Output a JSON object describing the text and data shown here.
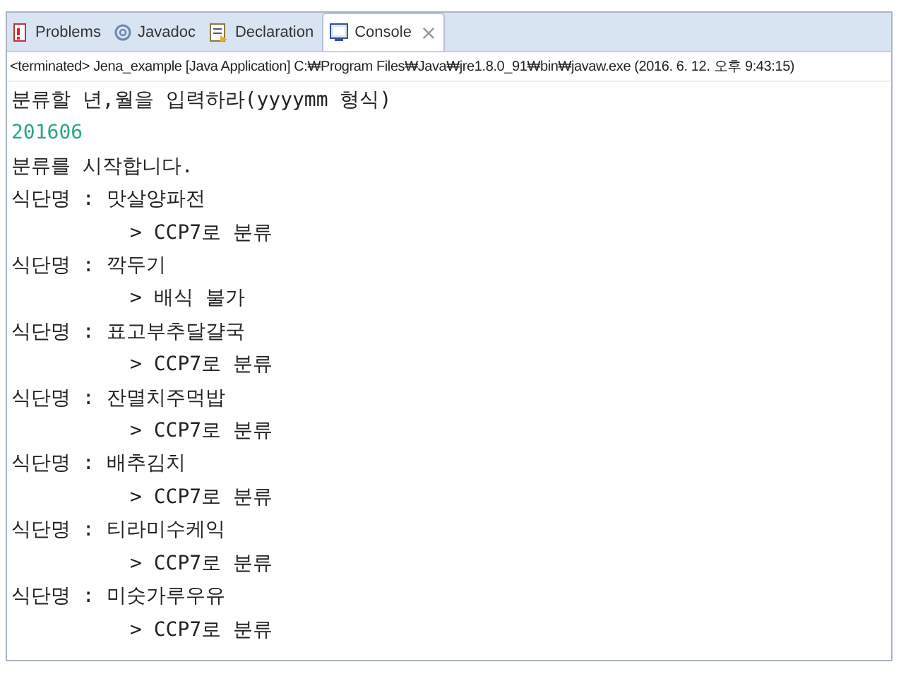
{
  "tabs": [
    {
      "label": "Problems",
      "selected": false
    },
    {
      "label": "Javadoc",
      "selected": false
    },
    {
      "label": "Declaration",
      "selected": false
    },
    {
      "label": "Console",
      "selected": true
    }
  ],
  "console_header": "<terminated> Jena_example [Java Application] C:₩Program Files₩Java₩jre1.8.0_91₩bin₩javaw.exe (2016. 6. 12. 오후 9:43:15)",
  "output_lines": [
    {
      "kind": "output",
      "text": "분류할 년,월을 입력하라(yyyymm 형식)"
    },
    {
      "kind": "input",
      "text": "201606"
    },
    {
      "kind": "output",
      "text": "분류를 시작합니다."
    },
    {
      "kind": "output",
      "text": "식단명 : 맛살양파전"
    },
    {
      "kind": "indented",
      "text": "> CCP7로 분류"
    },
    {
      "kind": "output",
      "text": "식단명 : 깍두기"
    },
    {
      "kind": "indented",
      "text": "> 배식 불가"
    },
    {
      "kind": "output",
      "text": "식단명 : 표고부추달걀국"
    },
    {
      "kind": "indented",
      "text": "> CCP7로 분류"
    },
    {
      "kind": "output",
      "text": "식단명 : 잔멸치주먹밥"
    },
    {
      "kind": "indented",
      "text": "> CCP7로 분류"
    },
    {
      "kind": "output",
      "text": "식단명 : 배추김치"
    },
    {
      "kind": "indented",
      "text": "> CCP7로 분류"
    },
    {
      "kind": "output",
      "text": "식단명 : 티라미수케익"
    },
    {
      "kind": "indented",
      "text": "> CCP7로 분류"
    },
    {
      "kind": "output",
      "text": "식단명 : 미숫가루우유"
    },
    {
      "kind": "indented",
      "text": "> CCP7로 분류"
    }
  ]
}
